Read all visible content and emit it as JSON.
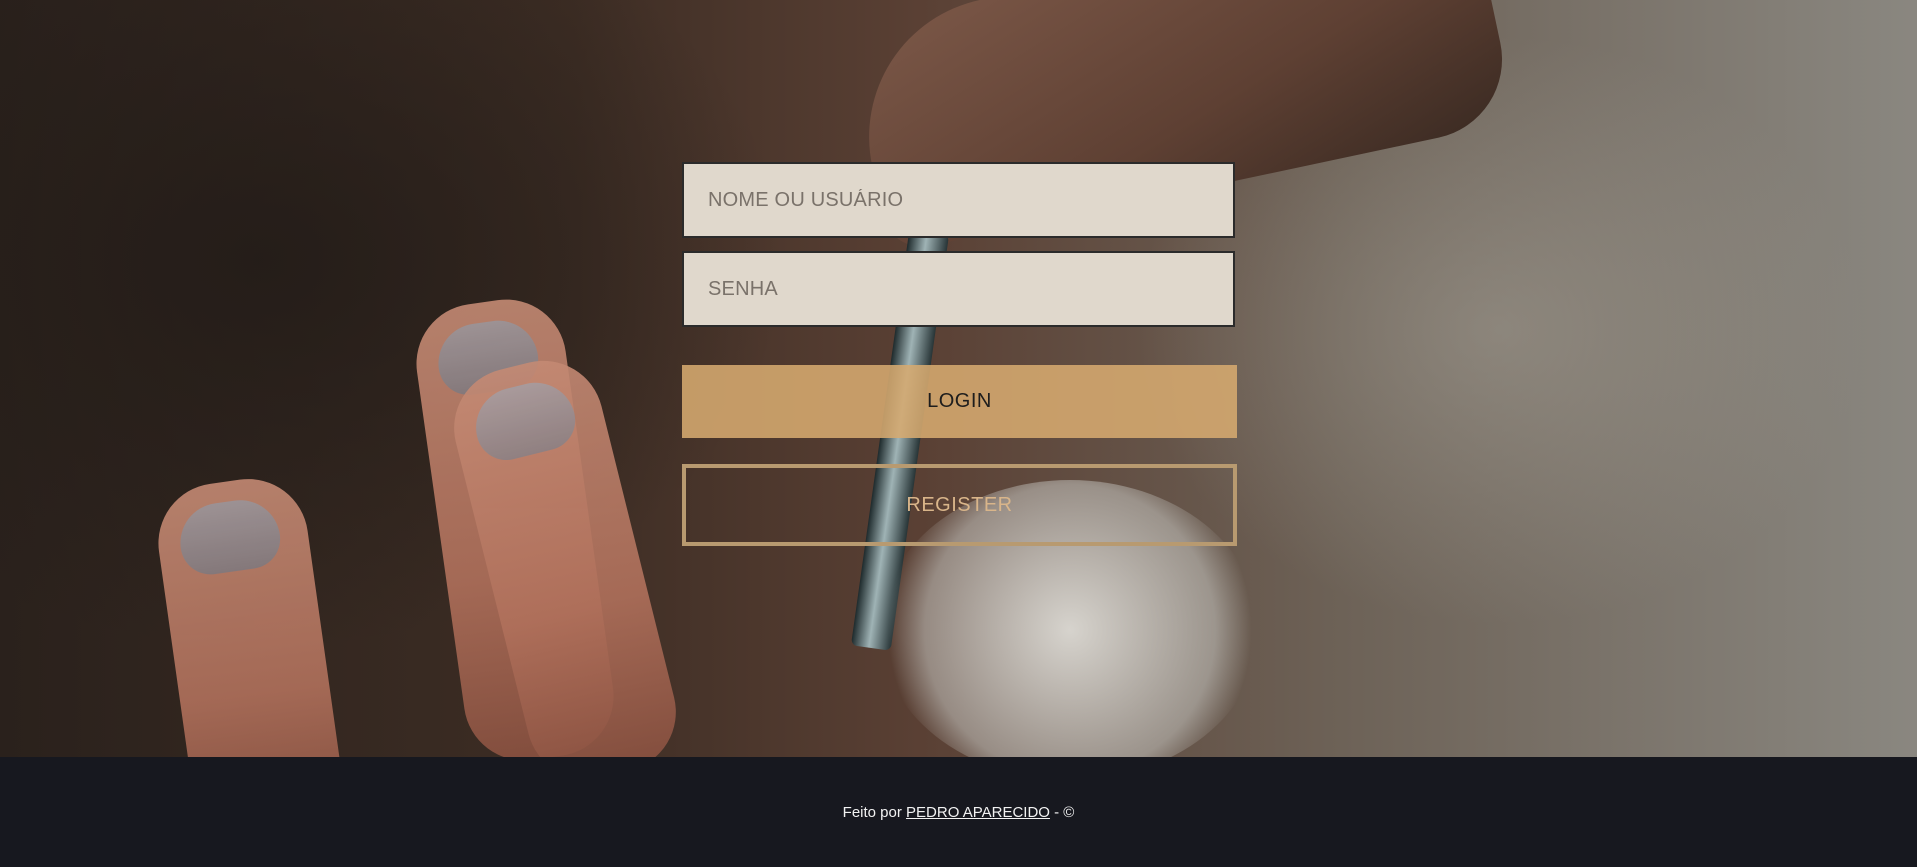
{
  "login_form": {
    "username_placeholder": "NOME OU USUÁRIO",
    "password_placeholder": "SENHA",
    "login_label": "LOGIN",
    "register_label": "REGISTER"
  },
  "footer": {
    "prefix": "Feito por ",
    "author_link": "PEDRO APARECIDO",
    "suffix": " - ©"
  },
  "colors": {
    "field_bg": "#e0d8cc",
    "login_bg": "#d6aa70",
    "register_border": "#b89a70",
    "footer_bg": "#17181f"
  }
}
